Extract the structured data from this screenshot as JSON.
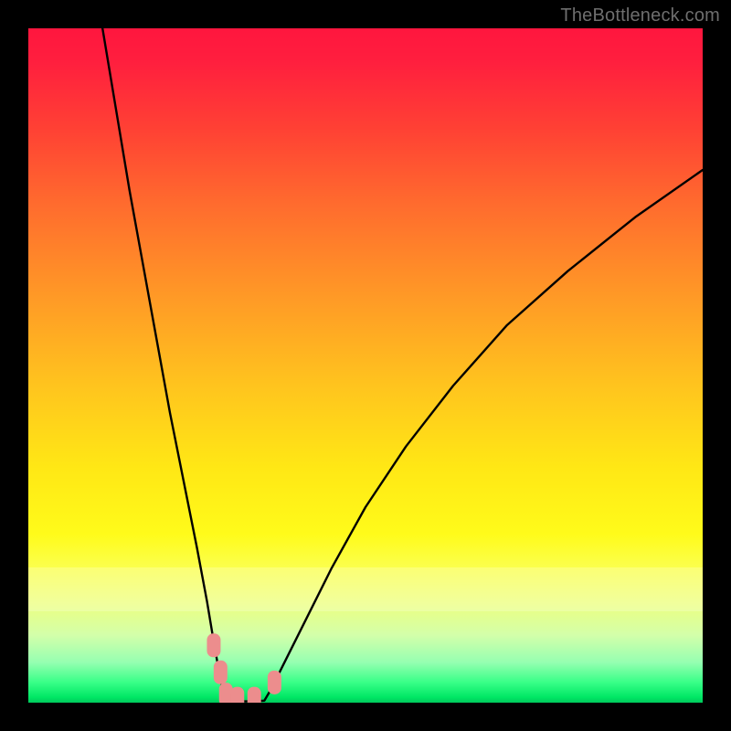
{
  "watermark": {
    "text": "TheBottleneck.com"
  },
  "chart_data": {
    "type": "line",
    "title": "",
    "xlabel": "",
    "ylabel": "",
    "xlim": [
      0,
      100
    ],
    "ylim": [
      0,
      100
    ],
    "series": [
      {
        "name": "left-branch",
        "x": [
          11,
          13,
          15,
          17,
          19,
          21,
          23,
          25,
          26.5,
          27.5,
          28.3,
          28.8,
          29.1,
          29.3
        ],
        "values": [
          100,
          88,
          76,
          65,
          54,
          43,
          33,
          23,
          15,
          9,
          4.5,
          2,
          0.8,
          0.3
        ]
      },
      {
        "name": "floor",
        "x": [
          29.3,
          31,
          33,
          35
        ],
        "values": [
          0.3,
          0.2,
          0.2,
          0.3
        ]
      },
      {
        "name": "right-branch",
        "x": [
          35,
          36,
          38,
          41,
          45,
          50,
          56,
          63,
          71,
          80,
          90,
          100
        ],
        "values": [
          0.3,
          2,
          6,
          12,
          20,
          29,
          38,
          47,
          56,
          64,
          72,
          79
        ]
      }
    ],
    "markers": [
      {
        "name": "marker-1",
        "x": 27.5,
        "y": 8.5
      },
      {
        "name": "marker-2",
        "x": 28.5,
        "y": 4.5
      },
      {
        "name": "marker-3",
        "x": 29.3,
        "y": 1.2
      },
      {
        "name": "marker-4",
        "x": 31.0,
        "y": 0.6
      },
      {
        "name": "marker-5",
        "x": 33.5,
        "y": 0.6
      },
      {
        "name": "marker-6",
        "x": 36.5,
        "y": 3.0
      }
    ],
    "colors": {
      "curve": "#000000",
      "marker_fill": "#ec8d8d",
      "background_top": "#ff163e",
      "background_bottom": "#00c95b"
    }
  }
}
